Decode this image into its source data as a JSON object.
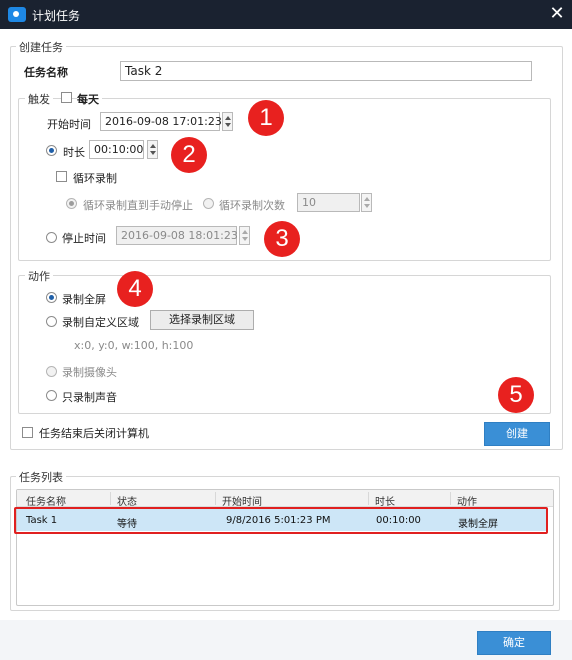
{
  "window": {
    "title": "计划任务",
    "close_icon": "close-icon"
  },
  "create_task": {
    "legend": "创建任务",
    "task_name_label": "任务名称",
    "task_name_value": "Task 2",
    "trigger": {
      "legend": "触发",
      "daily_label": "每天",
      "start_time_label": "开始时间",
      "start_time_value": "2016-09-08 17:01:23",
      "duration_label": "时长",
      "duration_value": "00:10:00",
      "loop_record_label": "循环录制",
      "loop_until_stop_label": "循环录制直到手动停止",
      "loop_count_label": "循环录制次数",
      "loop_count_value": "10",
      "stop_time_label": "停止时间",
      "stop_time_value": "2016-09-08 18:01:23"
    },
    "action": {
      "legend": "动作",
      "record_fullscreen_label": "录制全屏",
      "record_custom_label": "录制自定义区域",
      "select_region_button": "选择录制区域",
      "region_text": "x:0, y:0, w:100, h:100",
      "record_camera_label": "录制摄像头",
      "record_audio_label": "只录制声音"
    },
    "shutdown_label": "任务结束后关闭计算机",
    "create_button": "创建"
  },
  "task_list": {
    "legend": "任务列表",
    "columns": [
      "任务名称",
      "状态",
      "开始时间",
      "时长",
      "动作"
    ],
    "rows": [
      {
        "name": "Task 1",
        "status": "等待",
        "start": "9/8/2016 5:01:23 PM",
        "duration": "00:10:00",
        "action": "录制全屏"
      }
    ]
  },
  "confirm_button": "确定",
  "annotations": [
    "1",
    "2",
    "3",
    "4",
    "5"
  ],
  "colors": {
    "titlebar": "#1a2230",
    "accent_blue": "#3a8fd6",
    "annotation_red": "#e8211f",
    "row_selected": "#cde6f7"
  }
}
